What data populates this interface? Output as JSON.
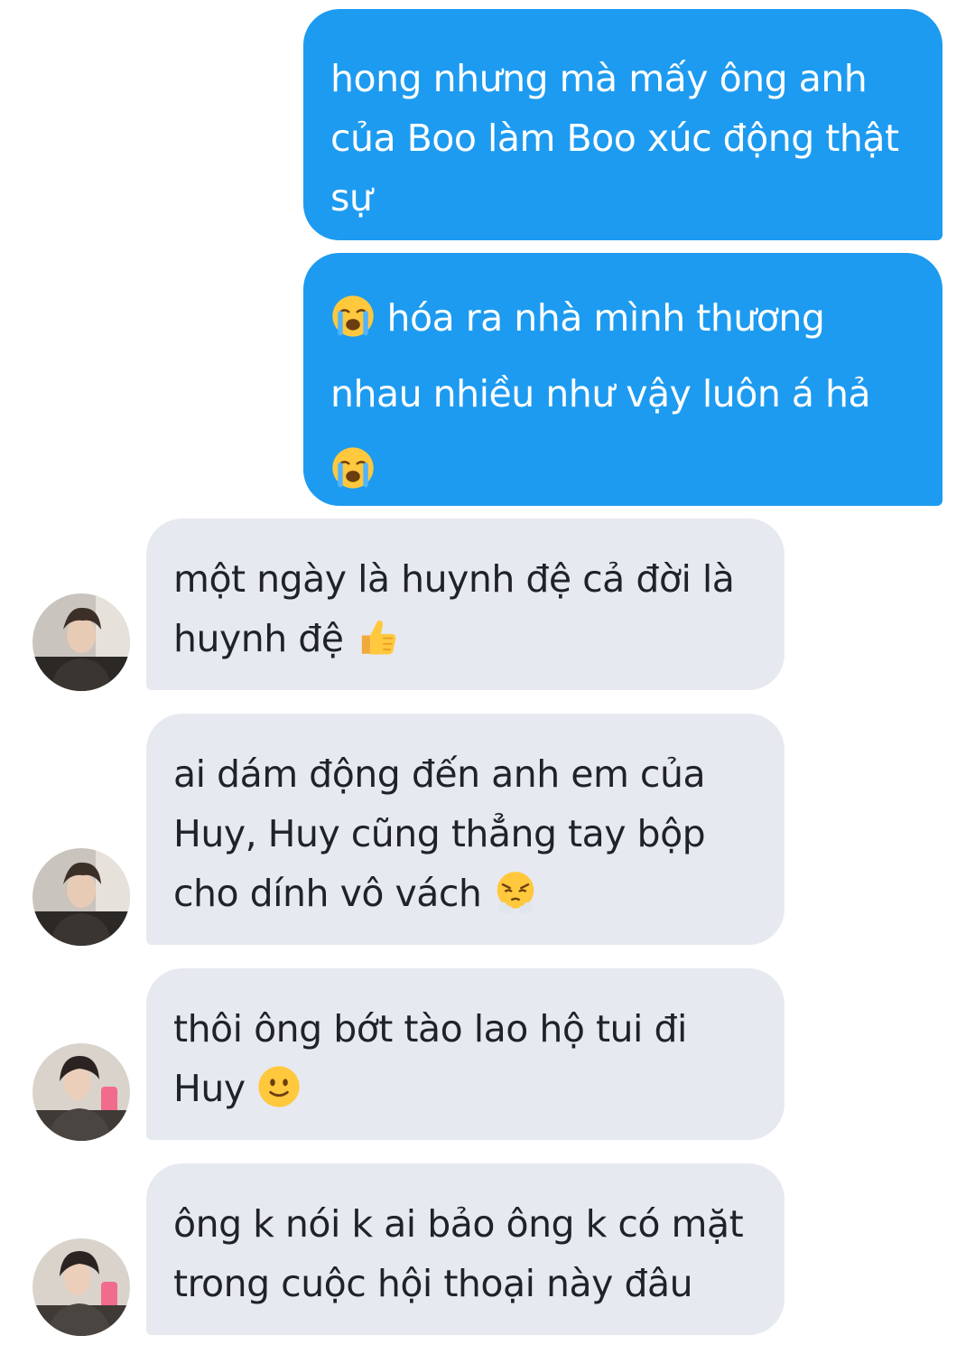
{
  "messages": [
    {
      "side": "outgoing",
      "lines": [
        "hong nhưng mà mấy ông anh",
        "của Boo làm Boo xúc động thật",
        "sự"
      ]
    },
    {
      "side": "outgoing",
      "lines": [
        "hóa ra nhà mình thương",
        "nhau nhiều như vậy luôn á hả"
      ],
      "emoji": [
        "loudly-crying-face",
        "loudly-crying-face"
      ]
    },
    {
      "side": "incoming",
      "lines": [
        "một ngày là huynh đệ cả đời là",
        "huynh đệ"
      ],
      "emoji": [
        "thumbs-up"
      ]
    },
    {
      "side": "incoming",
      "lines": [
        "ai dám động đến anh em của",
        "Huy, Huy cũng thẳng tay bộp",
        "cho dính vô vách"
      ],
      "emoji": [
        "face-with-steam-from-nose"
      ]
    },
    {
      "side": "incoming",
      "lines": [
        "thôi ông bớt tào lao hộ tui đi",
        "Huy"
      ],
      "emoji": [
        "slightly-smiling-face"
      ]
    },
    {
      "side": "incoming",
      "lines": [
        "ông k nói k ai bảo ông k có mặt",
        "trong cuộc hội thoại này đâu"
      ]
    }
  ],
  "colors": {
    "outgoing_bubble": "#1d9bf0",
    "incoming_bubble": "#e7e9f0",
    "outgoing_text": "#ffffff",
    "incoming_text": "#1f2328"
  }
}
